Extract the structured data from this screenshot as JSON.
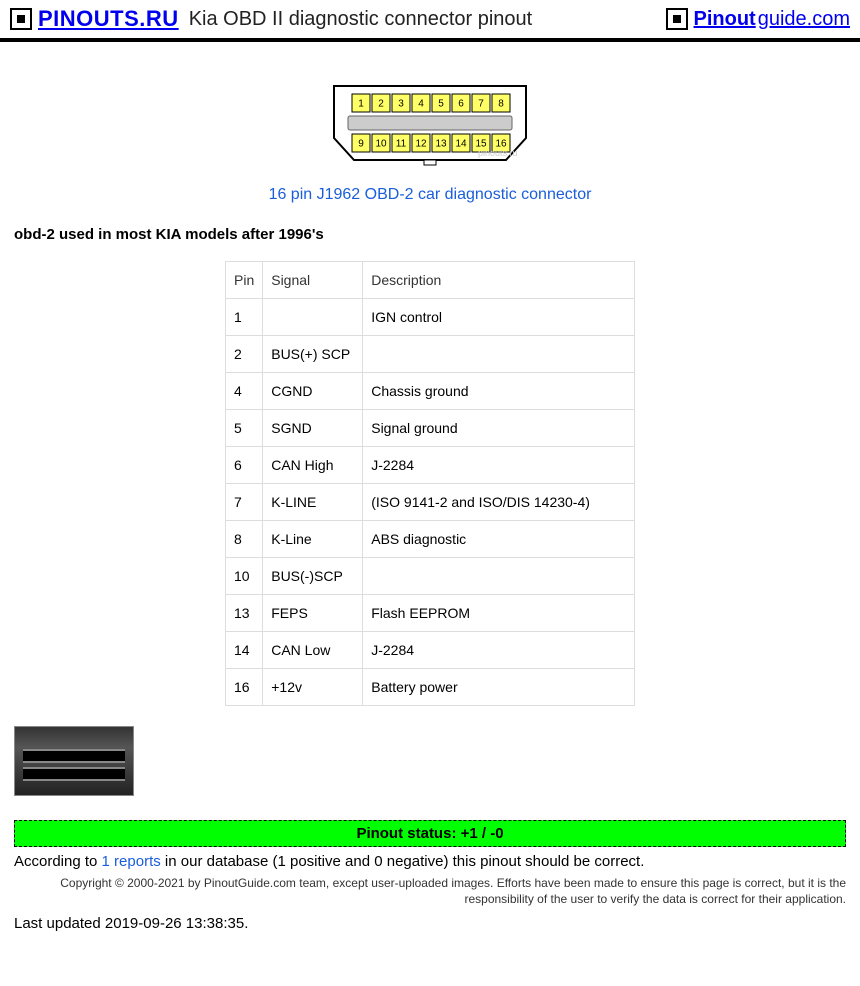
{
  "header": {
    "logo_left": "PINOUTS.RU",
    "title": "Kia OBD II diagnostic connector pinout",
    "logo_right_pin": "Pinout",
    "logo_right_guide": "guide.com"
  },
  "connector": {
    "link_text": "16 pin J1962 OBD-2 car diagnostic connector",
    "pins_top": [
      "1",
      "2",
      "3",
      "4",
      "5",
      "6",
      "7",
      "8"
    ],
    "pins_bottom": [
      "9",
      "10",
      "11",
      "12",
      "13",
      "14",
      "15",
      "16"
    ],
    "watermark": "pinouts.ru"
  },
  "intro": "obd-2 used in most KIA models after 1996's",
  "table": {
    "headers": [
      "Pin",
      "Signal",
      "Description"
    ],
    "rows": [
      {
        "pin": "1",
        "signal": "",
        "desc": "IGN control"
      },
      {
        "pin": "2",
        "signal": "BUS(+) SCP",
        "desc": ""
      },
      {
        "pin": "4",
        "signal": "CGND",
        "desc": "Chassis ground"
      },
      {
        "pin": "5",
        "signal": "SGND",
        "desc": "Signal ground"
      },
      {
        "pin": "6",
        "signal": "CAN High",
        "desc": "J-2284"
      },
      {
        "pin": "7",
        "signal": "K-LINE",
        "desc": "(ISO 9141-2 and ISO/DIS 14230-4)"
      },
      {
        "pin": "8",
        "signal": "K-Line",
        "desc": "ABS diagnostic"
      },
      {
        "pin": "10",
        "signal": "BUS(-)SCP",
        "desc": ""
      },
      {
        "pin": "13",
        "signal": "FEPS",
        "desc": "Flash EEPROM"
      },
      {
        "pin": "14",
        "signal": "CAN Low",
        "desc": "J-2284"
      },
      {
        "pin": "16",
        "signal": "+12v",
        "desc": "Battery power"
      }
    ]
  },
  "status": {
    "banner": "Pinout status: +1 / -0",
    "prefix": "According to ",
    "reports_link": "1 reports",
    "suffix": " in our database (1 positive and 0 negative) this pinout should be correct."
  },
  "copyright": "Copyright © 2000-2021 by PinoutGuide.com team, except user-uploaded images. Efforts have been made to ensure this page is correct, but it is the responsibility of the user to verify the data is correct for their application.",
  "updated": "Last updated 2019-09-26 13:38:35."
}
